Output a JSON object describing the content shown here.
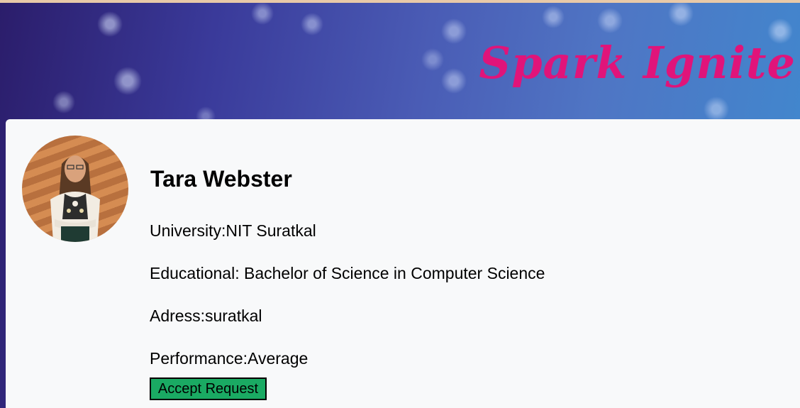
{
  "header": {
    "brand": "Spark Ignite"
  },
  "profile": {
    "name": "Tara Webster",
    "university": "University:NIT Suratkal",
    "educational": "Educational: Bachelor of Science in Computer Science",
    "address": "Adress:suratkal",
    "performance": "Performance:Average",
    "accept_label": "Accept Request"
  },
  "colors": {
    "brand": "#e0147a",
    "accept_button": "#1aaa63",
    "card_background": "#f8f9fa"
  }
}
